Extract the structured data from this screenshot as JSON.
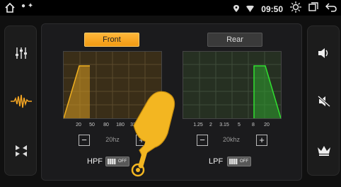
{
  "status": {
    "clock": "09:50"
  },
  "tabs": {
    "front": "Front",
    "rear": "Rear"
  },
  "hpf": {
    "ticks": [
      "20",
      "50",
      "80",
      "180",
      "32"
    ],
    "value": "20hz",
    "label": "HPF",
    "toggle_text": "OFF"
  },
  "lpf": {
    "ticks": [
      "1.25",
      "2",
      "3.15",
      "5",
      "8",
      "20"
    ],
    "value": "20khz",
    "label": "LPF",
    "toggle_text": "OFF"
  },
  "colors": {
    "accent": "#f5a623",
    "hpf_curve": "#f0b020",
    "lpf_curve": "#30e030"
  },
  "icons": {
    "left_sidebar": [
      "equalizer-sliders-icon",
      "sound-wave-icon",
      "balance-fader-icon"
    ],
    "right_sidebar": [
      "volume-icon",
      "mute-icon",
      "crown-icon"
    ],
    "status": [
      "home-icon",
      "location-icon",
      "wifi-icon",
      "brightness-icon",
      "window-icon",
      "back-icon"
    ]
  }
}
